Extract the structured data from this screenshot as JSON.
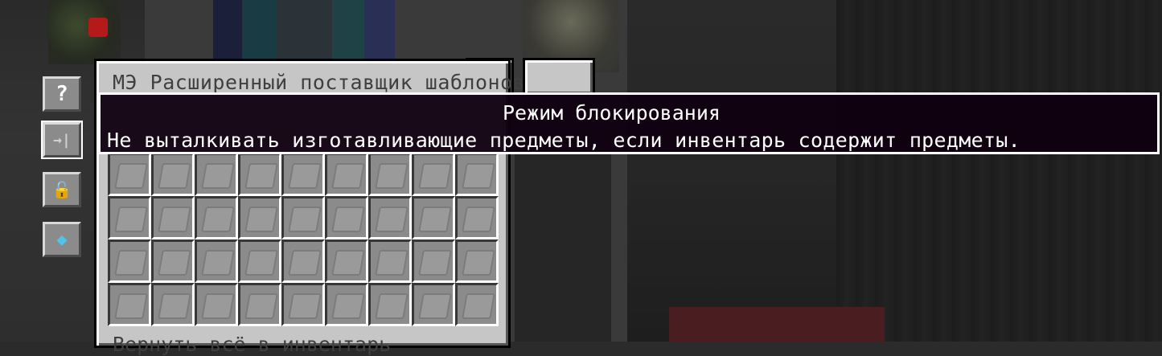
{
  "gui": {
    "title": "МЭ Расширенный поставщик шаблонов",
    "footer": "Вернуть всё в инвентарь"
  },
  "tooltip": {
    "title": "Режим блокирования",
    "description": "Не выталкивать изготавливающие предметы, если инвентарь содержит предметы."
  },
  "side_buttons": [
    {
      "icon": "help-icon",
      "glyph": "?"
    },
    {
      "icon": "blocking-mode-icon",
      "glyph": "→|"
    },
    {
      "icon": "lock-icon",
      "glyph": "🔓"
    },
    {
      "icon": "interface-terminal-icon",
      "glyph": "◆"
    }
  ],
  "slots": {
    "rows": 4,
    "cols": 9,
    "item": "blank-pattern-icon"
  }
}
